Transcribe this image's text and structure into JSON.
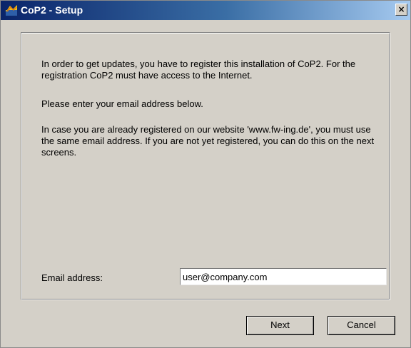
{
  "window": {
    "title": "CoP2 - Setup",
    "close_glyph": "×",
    "icon": "app-logo-icon"
  },
  "body": {
    "paragraph1": "In order to get updates, you have to register this installation of CoP2. For the registration CoP2 must have access to the Internet.",
    "paragraph2": "Please enter your email address below.",
    "paragraph3": "In case you are already registered on our website 'www.fw-ing.de', you must use the same email address. If you are not yet registered, you can do this on the next screens."
  },
  "form": {
    "email_label": "Email address:",
    "email_value": "user@company.com"
  },
  "buttons": {
    "next_label": "Next",
    "cancel_label": "Cancel"
  },
  "colors": {
    "dialog_bg": "#d4d0c8",
    "titlebar_start": "#0a246a",
    "titlebar_end": "#a6caf0"
  }
}
